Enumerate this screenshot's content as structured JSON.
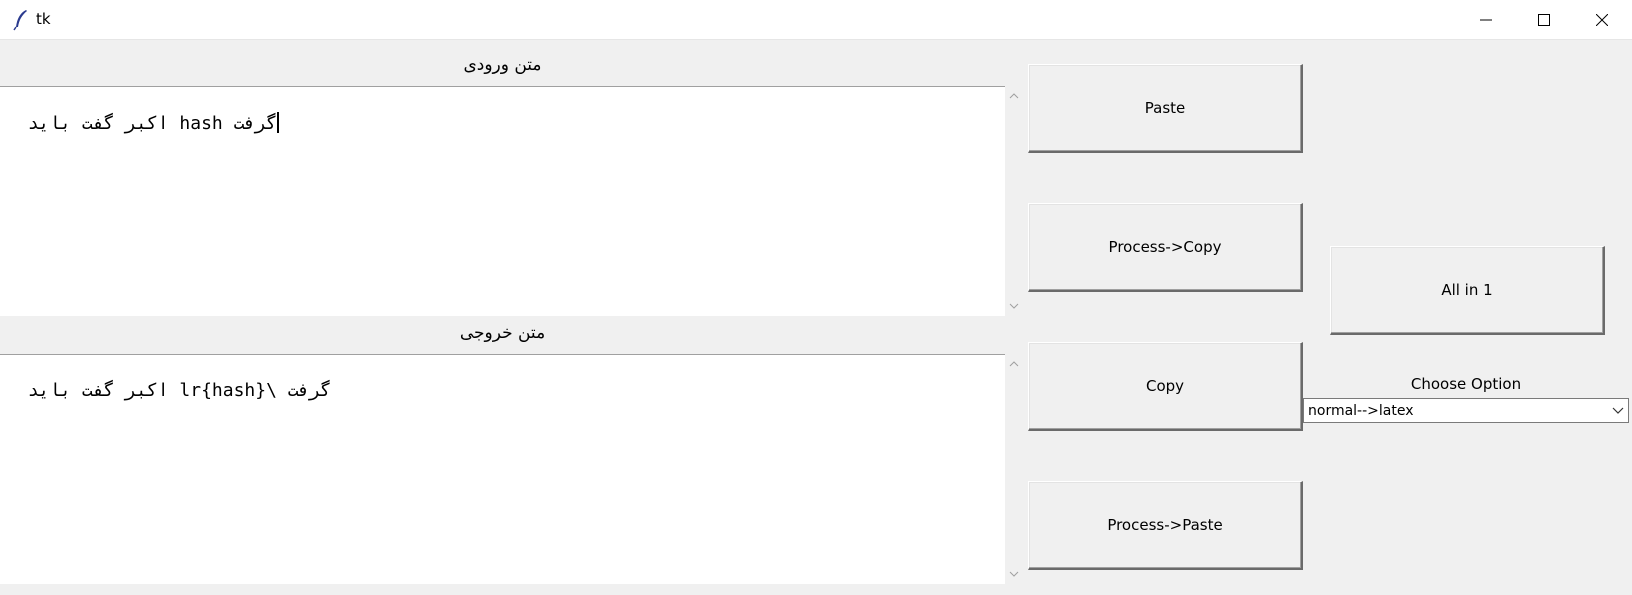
{
  "window": {
    "title": "tk",
    "controls": [
      "minimize-icon",
      "maximize-icon",
      "close-icon"
    ]
  },
  "input_section": {
    "label": "متن ورودی",
    "text": "گرفت hash اکبر گفت باید"
  },
  "output_section": {
    "label": "متن خروجی",
    "text": "گرفت \\lr{hash} اکبر گفت باید"
  },
  "buttons": {
    "paste": "Paste",
    "process_copy": "Process->Copy",
    "copy": "Copy",
    "process_paste": "Process->Paste",
    "all_in_1": "All in 1"
  },
  "option": {
    "label": "Choose Option",
    "selected": "normal-->latex"
  },
  "colors": {
    "window_bg": "#f0f0f0",
    "textbox_bg": "#ffffff",
    "titlebar_bg": "#ffffff"
  }
}
